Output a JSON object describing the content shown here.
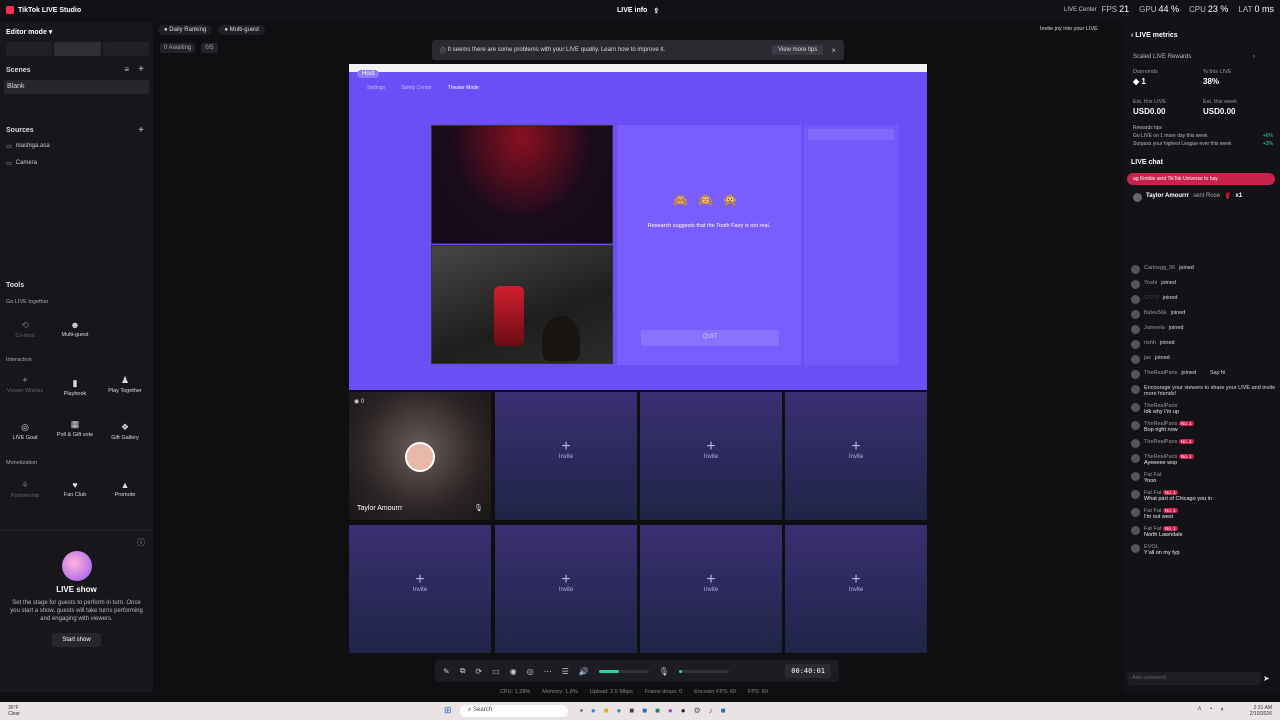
{
  "app": {
    "title": "TikTok LIVE Studio",
    "center_title": "LIVE info",
    "live_center": "LIVE Center",
    "stats": {
      "fps_label": "FPS",
      "fps": "21",
      "gpu_label": "GPU",
      "gpu": "44 %",
      "cpu_label": "CPU",
      "cpu": "23 %",
      "lat_label": "LAT",
      "lat": "0 ms"
    }
  },
  "left": {
    "mode": "Editor mode",
    "scenes_title": "Scenes",
    "scene": "Blank",
    "sources_title": "Sources",
    "sources": [
      "mashiga.asa",
      "Camera"
    ],
    "tools_title": "Tools",
    "go_live_together": "Go LIVE together",
    "cohost": "Co-host",
    "multiguest": "Multi-guest",
    "interaction": "Interaction",
    "viewer_wishes": "Viewer Wishes",
    "playbook": "Playbook",
    "play_together": "Play Together",
    "live_goal": "LIVE Goal",
    "poll": "Poll & Gift vote",
    "gift_gallery": "Gift Gallery",
    "monetization": "Monetization",
    "partnership": "Partnership",
    "fan_club": "Fan Club",
    "promote": "Promote",
    "live_show_title": "LIVE show",
    "live_show_desc": "Set the stage for guests to perform in turn. Once you start a show, guests will take turns performing and engaging with viewers.",
    "start_show": "Start show"
  },
  "top_chips": {
    "daily": "Daily Ranking",
    "multiguest": "Multi-guest",
    "awaiting": "0 Awaiting",
    "progress": "0/5"
  },
  "warning": {
    "text": "It seems there are some problems with your LIVE quality. Learn how to improve it.",
    "button": "View more tips"
  },
  "stage": {
    "host": "Host",
    "tabs": [
      "Settings",
      "Safety Center",
      "Theater Mode"
    ],
    "game_text": "Research suggests that the Tooth Fairy is not real.",
    "quit": "QUIT"
  },
  "guests": {
    "count": "0",
    "name": "Taylor Amourrr",
    "invite": "Invite"
  },
  "controls": {
    "timer": "00:40:01",
    "volume_fraction": 0.4
  },
  "footer": {
    "cpu": "CPU: 1.28%",
    "memory": "Memory: 1.8%",
    "upload": "Upload: 2.5 Mbps",
    "frame_drops": "Frame drops: 0",
    "encoder": "Encoder FPS: 60",
    "fps": "FPS: 60"
  },
  "invite_hint": "Invite joy into your LIVE",
  "right": {
    "metrics_title": "LIVE metrics",
    "rewards": "Scaled LIVE Rewards",
    "diamonds_label": "Diamonds",
    "diamonds": "1",
    "pct_label": "% this LIVE",
    "pct": "38%",
    "est_live_label": "Est. this LIVE",
    "est_live": "USD0.00",
    "est_week_label": "Est. this week",
    "est_week": "USD0.00",
    "tips_title": "Rewards tips",
    "tip1": "Go LIVE on 1 more day this week",
    "tip1_val": "+6%",
    "tip2": "Surpass your highest League ever this week",
    "tip2_val": "+3%",
    "chat_title": "LIVE chat",
    "gift_banner": "ag Kimble sent TikTok Universe to hay",
    "gift_user": "Taylor Amourrr",
    "gift_action": "sent Rose",
    "gift_count": "x1",
    "say_hi": "Say hi",
    "chat": [
      {
        "name": "Carlosgg_96",
        "text": "joined"
      },
      {
        "name": "Yoshi",
        "text": "joined"
      },
      {
        "name": "♡♡♡",
        "text": "joined"
      },
      {
        "name": "Bidev56k",
        "text": "joined"
      },
      {
        "name": "Jameela",
        "text": "joined"
      },
      {
        "name": "rishh",
        "text": "joined"
      },
      {
        "name": "jas",
        "text": "joined"
      },
      {
        "name": "TheRealParis",
        "text": "joined"
      }
    ],
    "encourage": "Encourage your viewers to share your LIVE and invite more friends!",
    "messages": [
      {
        "name": "TheRealParis",
        "text": "Idk why I'm up"
      },
      {
        "name": "TheRealParis",
        "badge": "No. 1",
        "text": "Bop right now"
      },
      {
        "name": "TheRealParis",
        "badge": "No. 1",
        "text": ""
      },
      {
        "name": "TheRealParis",
        "badge": "No. 1",
        "text": "Ayeeeee wop"
      },
      {
        "name": "Fat Fat",
        "text": "Yooo"
      },
      {
        "name": "Fat Fat",
        "badge": "No. 1",
        "text": "What part of Chicago you in"
      },
      {
        "name": "Fat Fat",
        "badge": "No. 1",
        "text": "I'm out west"
      },
      {
        "name": "Fat Fat",
        "badge": "No. 1",
        "text": "North Lawndale"
      },
      {
        "name": "EVOL",
        "text": "Y'all on my fyp"
      }
    ],
    "comment_placeholder": "Add comment"
  },
  "taskbar": {
    "weather_temp": "36°F",
    "weather": "Clear",
    "search": "Search",
    "time": "2:31 AM",
    "date": "2/10/2026"
  }
}
